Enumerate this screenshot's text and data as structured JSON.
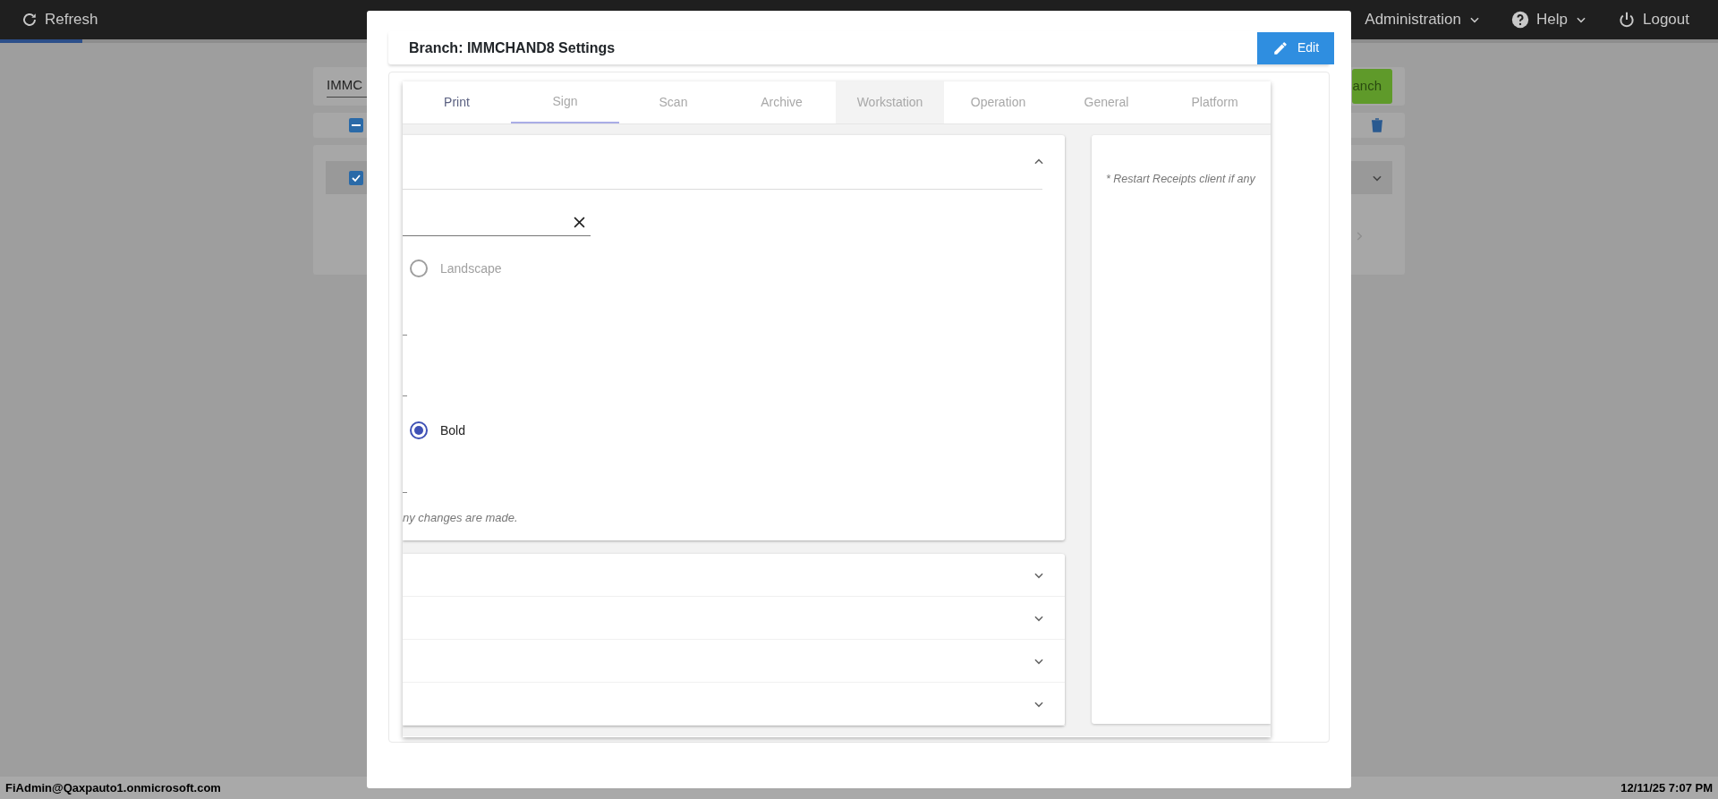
{
  "top_bar": {
    "refresh": "Refresh",
    "menus": [
      {
        "label": "Administration",
        "kind": "dropdown"
      },
      {
        "label": "Help",
        "kind": "help"
      },
      {
        "label": "Logout",
        "kind": "logout"
      }
    ]
  },
  "background_page": {
    "branch_field": {
      "value": "IMMC"
    },
    "add_button": "anch",
    "select_all": {
      "indeterminate": true
    },
    "row_checkbox": {
      "checked": true
    }
  },
  "modal": {
    "title": "Branch: IMMCHAND8 Settings",
    "edit_button": "Edit",
    "tabs": [
      {
        "label": "Print",
        "selected": true,
        "underlined": false,
        "hovered": false
      },
      {
        "label": "Sign",
        "selected": false,
        "underlined": true,
        "hovered": false
      },
      {
        "label": "Scan",
        "selected": false,
        "underlined": false,
        "hovered": false
      },
      {
        "label": "Archive",
        "selected": false,
        "underlined": false,
        "hovered": false
      },
      {
        "label": "Workstation",
        "selected": false,
        "underlined": false,
        "hovered": true
      },
      {
        "label": "Operation",
        "selected": false,
        "underlined": false,
        "hovered": false
      },
      {
        "label": "General",
        "selected": false,
        "underlined": false,
        "hovered": false
      },
      {
        "label": "Platform",
        "selected": false,
        "underlined": false,
        "hovered": false
      }
    ],
    "main_section": {
      "expanded": true,
      "options": [
        {
          "label": "Landscape",
          "selected": false,
          "disabled": true
        },
        {
          "label": "Bold",
          "selected": true,
          "disabled": false
        }
      ],
      "note": "ny changes are made."
    },
    "collapsed_sections": [
      {
        "expanded": false
      },
      {
        "expanded": false
      },
      {
        "expanded": false
      },
      {
        "expanded": false
      }
    ],
    "side_note": "* Restart Receipts client if any"
  },
  "status_bar": {
    "user": "FiAdmin@Qaxpauto1.onmicrosoft.com",
    "datetime": "12/11/25 7:07 PM"
  }
}
